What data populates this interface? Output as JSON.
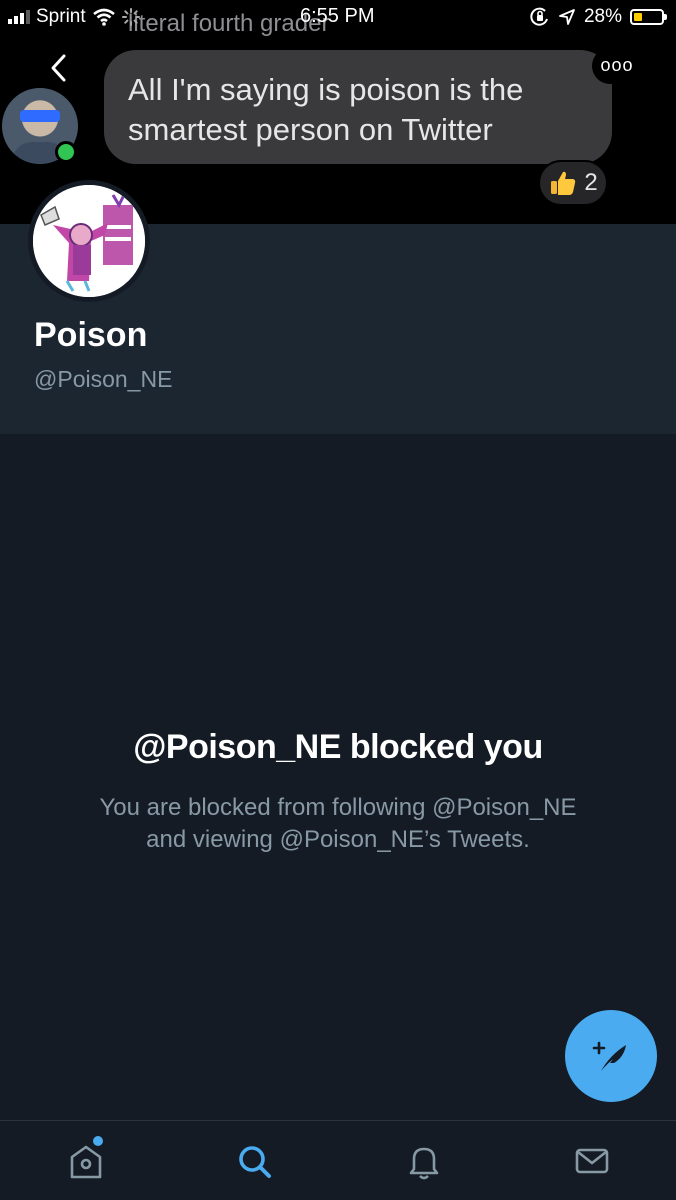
{
  "status_bar": {
    "carrier": "Sprint",
    "time": "6:55 PM",
    "battery_percent": "28%",
    "battery_level": 0.28
  },
  "chat_overlay": {
    "title": "literal fourth grader",
    "message": "All I'm saying is poison is the smartest person on Twitter",
    "more_label": "ooo",
    "reaction_count": "2",
    "reaction_icon": "thumbs-up-emoji",
    "online_status_color": "#31c553"
  },
  "profile": {
    "name": "Poison",
    "handle": "@Poison_NE"
  },
  "blocked": {
    "title": "@Poison_NE blocked you",
    "line1": "You are blocked from following @Poison_NE",
    "line2": "and viewing @Poison_NE’s Tweets."
  },
  "fab": {
    "icon": "compose-tweet-icon"
  },
  "tabs": [
    {
      "icon": "home-icon",
      "active": false,
      "has_notification_dot": true
    },
    {
      "icon": "search-icon",
      "active": true
    },
    {
      "icon": "notifications-bell-icon",
      "active": false
    },
    {
      "icon": "messages-envelope-icon",
      "active": false
    }
  ],
  "colors": {
    "accent": "#4aabf0",
    "background": "#141b25",
    "header_background": "#1c2631",
    "secondary_text": "#8899a6"
  }
}
